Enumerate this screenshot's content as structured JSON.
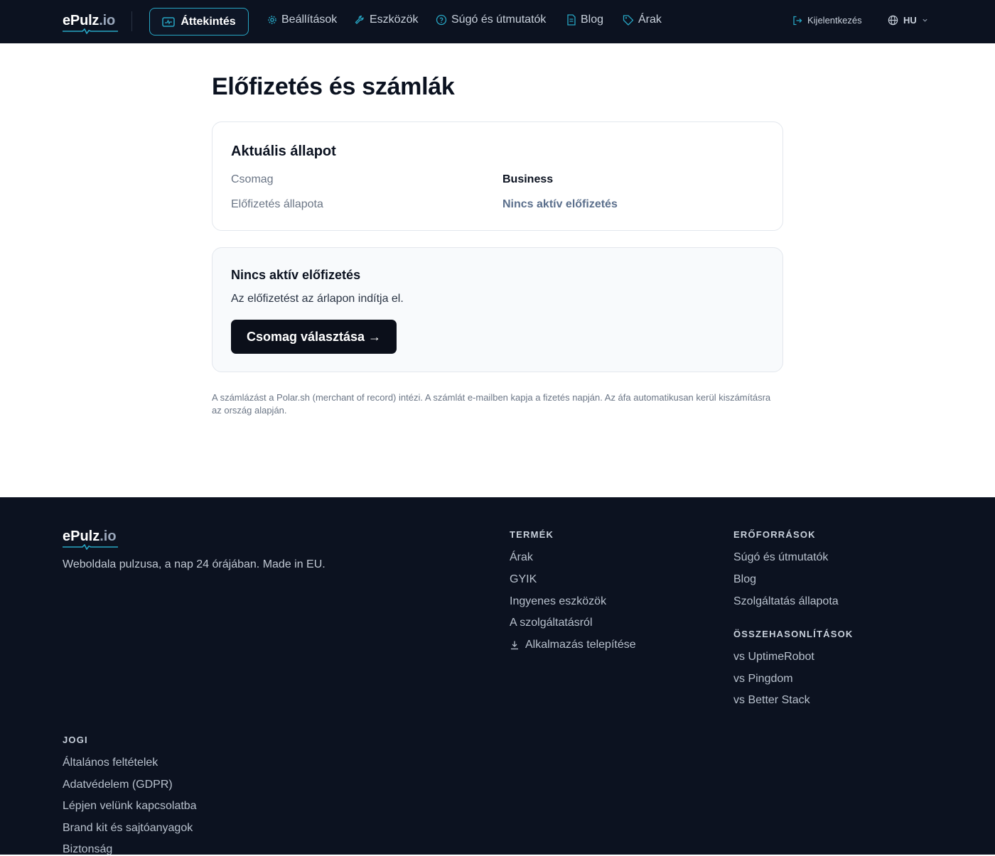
{
  "nav": {
    "logo_main": "ePulz",
    "logo_tld": ".io",
    "active_tab": "Áttekintés",
    "items": [
      {
        "label": "Beállítások",
        "icon": "gear-icon"
      },
      {
        "label": "Eszközök",
        "icon": "wrench-icon"
      },
      {
        "label": "Súgó és útmutatók",
        "icon": "help-circle-icon"
      },
      {
        "label": "Blog",
        "icon": "document-icon"
      },
      {
        "label": "Árak",
        "icon": "tag-icon"
      }
    ],
    "logout": "Kijelentkezés",
    "language": "HU"
  },
  "page": {
    "title": "Előfizetés és számlák"
  },
  "status_card": {
    "heading": "Aktuális állapot",
    "rows": [
      {
        "label": "Csomag",
        "value": "Business"
      },
      {
        "label": "Előfizetés állapota",
        "value": "Nincs aktív előfizetés"
      }
    ]
  },
  "empty_card": {
    "heading": "Nincs aktív előfizetés",
    "text": "Az előfizetést az árlapon indítja el.",
    "button": "Csomag választása →"
  },
  "billing_note": "A számlázást a Polar.sh (merchant of record) intézi. A számlát e-mailben kapja a fizetés napján. Az áfa automatikusan kerül kiszámításra az ország alapján.",
  "footer": {
    "logo_main": "ePulz",
    "logo_tld": ".io",
    "tagline": "Weboldala pulzusa, a nap 24 órájában. Made in EU.",
    "product": {
      "heading": "TERMÉK",
      "links": [
        "Árak",
        "GYIK",
        "Ingyenes eszközök",
        "A szolgáltatásról",
        "Alkalmazás telepítése"
      ]
    },
    "resources": {
      "heading": "ERŐFORRÁSOK",
      "links": [
        "Súgó és útmutatók",
        "Blog",
        "Szolgáltatás állapota"
      ]
    },
    "comparisons": {
      "heading": "ÖSSZEHASONLÍTÁSOK",
      "links": [
        "vs UptimeRobot",
        "vs Pingdom",
        "vs Better Stack"
      ]
    },
    "legal": {
      "heading": "JOGI",
      "links": [
        "Általános feltételek",
        "Adatvédelem (GDPR)",
        "Lépjen velünk kapcsolatba",
        "Brand kit és sajtóanyagok",
        "Biztonság"
      ]
    }
  },
  "colors": {
    "nav_bg": "#0c1220",
    "accent": "#27a6c4",
    "status_muted": "#5b6f8c",
    "button_bg": "#0b0f1a"
  }
}
